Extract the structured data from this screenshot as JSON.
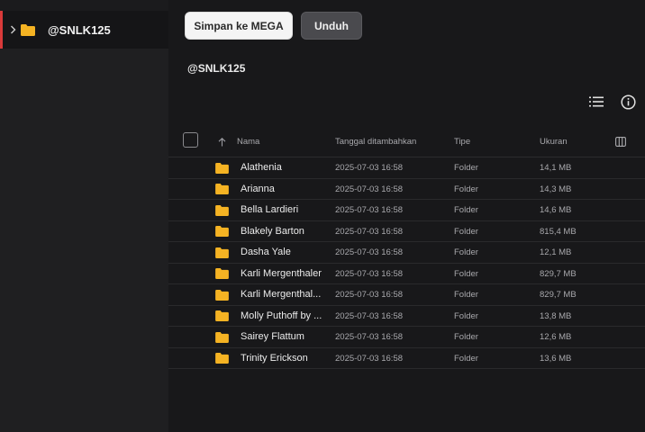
{
  "sidebar": {
    "items": [
      {
        "label": "@SNLK125",
        "icon": "folder-icon",
        "expand_icon": "chevron-right-icon",
        "selected": true
      }
    ],
    "accent_color": "#d93a3a"
  },
  "toolbar": {
    "save_label": "Simpan ke MEGA",
    "download_label": "Unduh",
    "list_view_icon": "list-view-icon",
    "info_icon": "info-icon"
  },
  "main": {
    "folder_title": "@SNLK125"
  },
  "table": {
    "headers": {
      "name": "Nama",
      "date": "Tanggal ditambahkan",
      "type": "Tipe",
      "size": "Ukuran"
    },
    "rows": [
      {
        "name": "Alathenia",
        "date": "2025-07-03 16:58",
        "type": "Folder",
        "size": "14,1 MB"
      },
      {
        "name": "Arianna",
        "date": "2025-07-03 16:58",
        "type": "Folder",
        "size": "14,3 MB"
      },
      {
        "name": "Bella Lardieri",
        "date": "2025-07-03 16:58",
        "type": "Folder",
        "size": "14,6 MB"
      },
      {
        "name": "Blakely Barton",
        "date": "2025-07-03 16:58",
        "type": "Folder",
        "size": "815,4 MB"
      },
      {
        "name": "Dasha Yale",
        "date": "2025-07-03 16:58",
        "type": "Folder",
        "size": "12,1 MB"
      },
      {
        "name": "Karli Mergenthaler",
        "date": "2025-07-03 16:58",
        "type": "Folder",
        "size": "829,7 MB"
      },
      {
        "name": "Karli Mergenthal...",
        "date": "2025-07-03 16:58",
        "type": "Folder",
        "size": "829,7 MB"
      },
      {
        "name": "Molly Puthoff by ...",
        "date": "2025-07-03 16:58",
        "type": "Folder",
        "size": "13,8 MB"
      },
      {
        "name": "Sairey Flattum",
        "date": "2025-07-03 16:58",
        "type": "Folder",
        "size": "12,6 MB"
      },
      {
        "name": "Trinity Erickson",
        "date": "2025-07-03 16:58",
        "type": "Folder",
        "size": "13,6 MB"
      }
    ],
    "folder_color": "#f5b323"
  }
}
